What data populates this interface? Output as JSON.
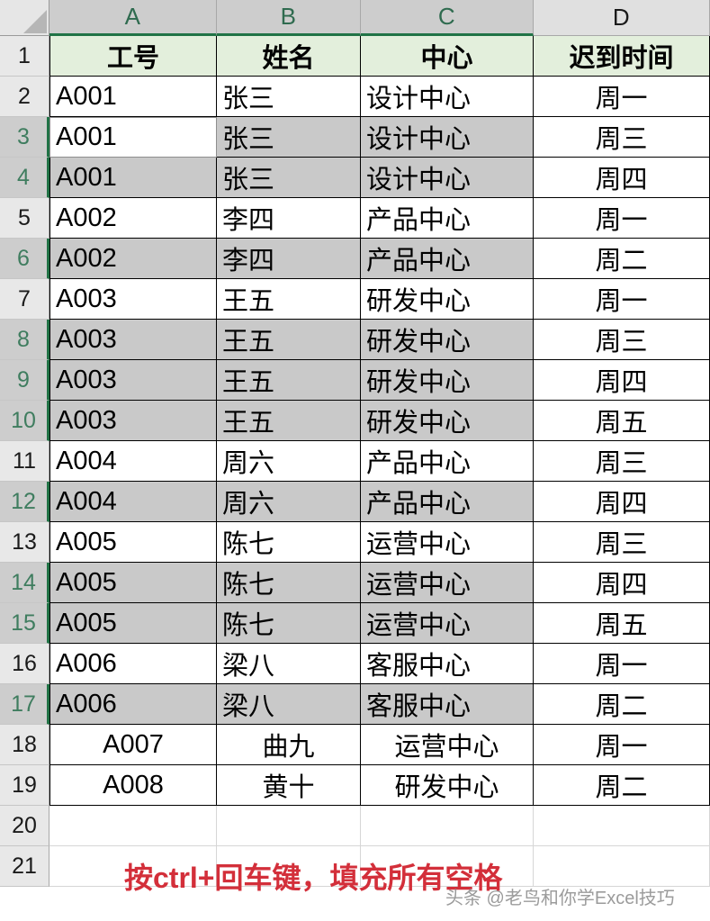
{
  "app": "excel-worksheet",
  "grid": {
    "column_headers": [
      "A",
      "B",
      "C",
      "D"
    ],
    "row_headers": [
      "1",
      "2",
      "3",
      "4",
      "5",
      "6",
      "7",
      "8",
      "9",
      "10",
      "11",
      "12",
      "13",
      "14",
      "15",
      "16",
      "17",
      "18",
      "19",
      "20",
      "21"
    ],
    "selected_columns": [
      "A",
      "B",
      "C"
    ],
    "selected_rows": [
      "3",
      "4",
      "6",
      "8",
      "9",
      "10",
      "12",
      "14",
      "15",
      "17"
    ],
    "active_cell": "A3",
    "accent_color": "#217346",
    "header_fill": "#e3efdc",
    "selection_fill": "#c9c9c9"
  },
  "table": {
    "headers": [
      "工号",
      "姓名",
      "中心",
      "迟到时间"
    ],
    "rows": [
      {
        "row": "2",
        "id": "A001",
        "name": "张三",
        "center": "设计中心",
        "day": "周一",
        "selected": false,
        "align": "left"
      },
      {
        "row": "3",
        "id": "A001",
        "name": "张三",
        "center": "设计中心",
        "day": "周三",
        "selected": true,
        "align": "left"
      },
      {
        "row": "4",
        "id": "A001",
        "name": "张三",
        "center": "设计中心",
        "day": "周四",
        "selected": true,
        "align": "left"
      },
      {
        "row": "5",
        "id": "A002",
        "name": "李四",
        "center": "产品中心",
        "day": "周一",
        "selected": false,
        "align": "left"
      },
      {
        "row": "6",
        "id": "A002",
        "name": "李四",
        "center": "产品中心",
        "day": "周二",
        "selected": true,
        "align": "left"
      },
      {
        "row": "7",
        "id": "A003",
        "name": "王五",
        "center": "研发中心",
        "day": "周一",
        "selected": false,
        "align": "left"
      },
      {
        "row": "8",
        "id": "A003",
        "name": "王五",
        "center": "研发中心",
        "day": "周三",
        "selected": true,
        "align": "left"
      },
      {
        "row": "9",
        "id": "A003",
        "name": "王五",
        "center": "研发中心",
        "day": "周四",
        "selected": true,
        "align": "left"
      },
      {
        "row": "10",
        "id": "A003",
        "name": "王五",
        "center": "研发中心",
        "day": "周五",
        "selected": true,
        "align": "left"
      },
      {
        "row": "11",
        "id": "A004",
        "name": "周六",
        "center": "产品中心",
        "day": "周三",
        "selected": false,
        "align": "left"
      },
      {
        "row": "12",
        "id": "A004",
        "name": "周六",
        "center": "产品中心",
        "day": "周四",
        "selected": true,
        "align": "left"
      },
      {
        "row": "13",
        "id": "A005",
        "name": "陈七",
        "center": "运营中心",
        "day": "周三",
        "selected": false,
        "align": "left"
      },
      {
        "row": "14",
        "id": "A005",
        "name": "陈七",
        "center": "运营中心",
        "day": "周四",
        "selected": true,
        "align": "left"
      },
      {
        "row": "15",
        "id": "A005",
        "name": "陈七",
        "center": "运营中心",
        "day": "周五",
        "selected": true,
        "align": "left"
      },
      {
        "row": "16",
        "id": "A006",
        "name": "梁八",
        "center": "客服中心",
        "day": "周一",
        "selected": false,
        "align": "left"
      },
      {
        "row": "17",
        "id": "A006",
        "name": "梁八",
        "center": "客服中心",
        "day": "周二",
        "selected": true,
        "align": "left"
      },
      {
        "row": "18",
        "id": "A007",
        "name": "曲九",
        "center": "运营中心",
        "day": "周一",
        "selected": false,
        "align": "center"
      },
      {
        "row": "19",
        "id": "A008",
        "name": "黄十",
        "center": "研发中心",
        "day": "周二",
        "selected": false,
        "align": "center"
      }
    ],
    "empty_rows": [
      "20",
      "21"
    ]
  },
  "annotation": {
    "text": "按ctrl+回车键，填充所有空格",
    "color": "#d32f3a"
  },
  "watermark": {
    "text": "头条 @老鸟和你学Excel技巧"
  }
}
